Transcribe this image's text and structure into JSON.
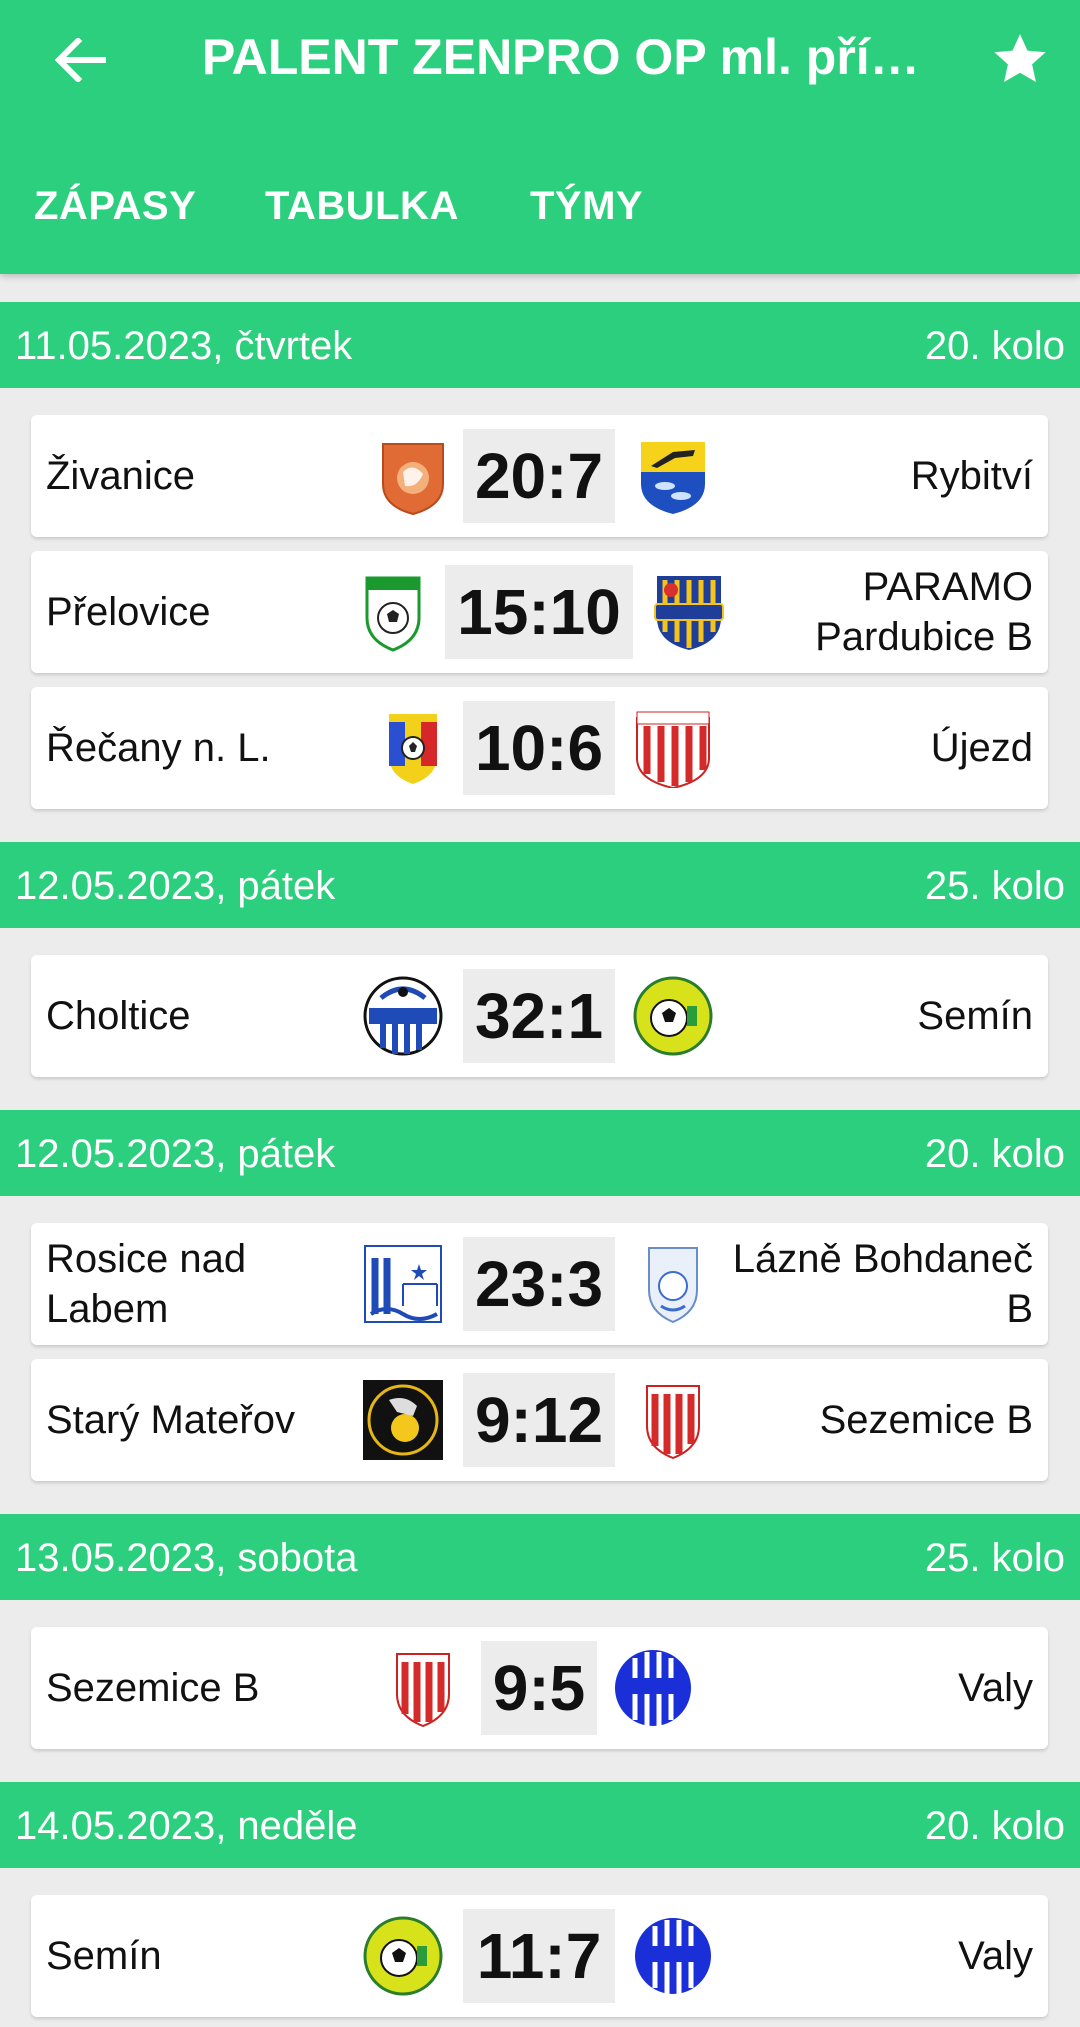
{
  "app": {
    "title": "PALENT ZENPRO OP ml. přípr...",
    "tabs": [
      "ZÁPASY",
      "TABULKA",
      "TÝMY"
    ]
  },
  "colors": {
    "accent": "#2bcf7d",
    "background": "#ececec"
  },
  "days": [
    {
      "date": "11.05.2023, čtvrtek",
      "round": "20. kolo",
      "matches": [
        {
          "home": "Živanice",
          "score": "20:7",
          "away": "Rybitví"
        },
        {
          "home": "Přelovice",
          "score": "15:10",
          "away": "PARAMO Pardubice B"
        },
        {
          "home": "Řečany n. L.",
          "score": "10:6",
          "away": "Újezd"
        }
      ]
    },
    {
      "date": "12.05.2023, pátek",
      "round": "25. kolo",
      "matches": [
        {
          "home": "Choltice",
          "score": "32:1",
          "away": "Semín"
        }
      ]
    },
    {
      "date": "12.05.2023, pátek",
      "round": "20. kolo",
      "matches": [
        {
          "home": "Rosice nad Labem",
          "score": "23:3",
          "away": "Lázně Bohdaneč B"
        },
        {
          "home": "Starý Mateřov",
          "score": "9:12",
          "away": "Sezemice B"
        }
      ]
    },
    {
      "date": "13.05.2023, sobota",
      "round": "25. kolo",
      "matches": [
        {
          "home": "Sezemice B",
          "score": "9:5",
          "away": "Valy"
        }
      ]
    },
    {
      "date": "14.05.2023, neděle",
      "round": "20. kolo",
      "matches": [
        {
          "home": "Semín",
          "score": "11:7",
          "away": "Valy"
        }
      ]
    }
  ]
}
